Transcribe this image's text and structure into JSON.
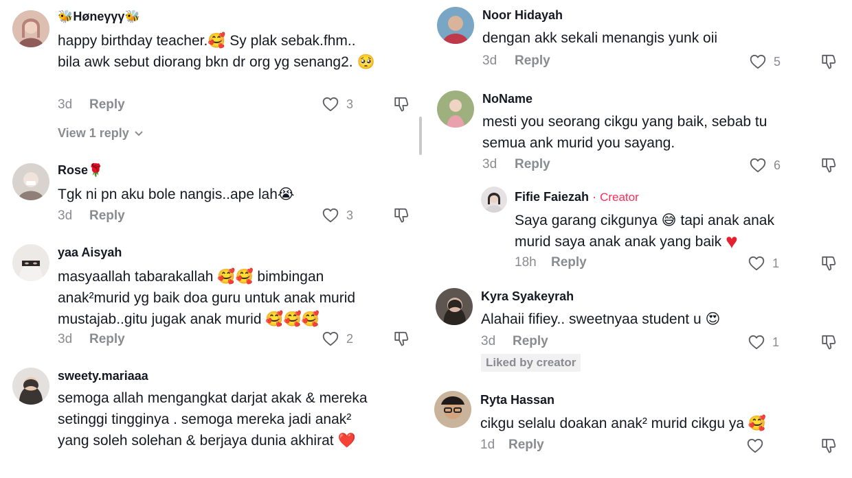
{
  "colors": {
    "text": "#161823",
    "muted": "#8a8b91",
    "creator": "#fe2c55",
    "heart": "#e5202f",
    "badge_bg": "#f1f1f2"
  },
  "left": {
    "c1": {
      "name": "🐝Høneγγγ🐝",
      "text": "happy birthday teacher.🥰 Sy plak sebak.fhm.. bila awk sebut diorang bkn dr org yg senang2. 🥺",
      "age": "3d",
      "reply": "Reply",
      "likes": "3",
      "view_replies": "View 1 reply"
    },
    "c2": {
      "name": "Rose🌹",
      "text": "Tgk ni pn aku bole nangis..ape lah😭",
      "age": "3d",
      "reply": "Reply",
      "likes": "3"
    },
    "c3": {
      "name": "yaa Aisyah",
      "text": "masyaallah tabarakallah 🥰🥰 bimbingan anak²murid yg baik doa guru untuk anak murid mustajab..gitu jugak anak murid 🥰🥰🥰",
      "age": "3d",
      "reply": "Reply",
      "likes": "2"
    },
    "c4": {
      "name": "sweety.mariaaa",
      "text": "semoga allah mengangkat darjat akak & mereka setinggi tingginya . semoga mereka jadi anak² yang soleh solehan & berjaya dunia akhirat ❤️"
    }
  },
  "right": {
    "c1": {
      "name": "Noor Hidayah",
      "text": "dengan akk sekali menangis yunk oii",
      "age": "3d",
      "reply": "Reply",
      "likes": "5"
    },
    "c2": {
      "name": "NoName",
      "text": "mesti you seorang cikgu yang baik, sebab tu semua ank murid you sayang.",
      "age": "3d",
      "reply": "Reply",
      "likes": "6"
    },
    "c3": {
      "name": "Fifie Faiezah",
      "dot": "·",
      "creator": "Creator",
      "text_a": "Saya garang cikgunya 😅 tapi anak anak murid saya anak anak yang baik ",
      "heart": "♥",
      "age": "18h",
      "reply": "Reply",
      "likes": "1"
    },
    "c4": {
      "name": "Kyra Syakeyrah",
      "text": "Alahaii fifiey.. sweetnyaa student u 😍",
      "age": "3d",
      "reply": "Reply",
      "likes": "1",
      "liked_by": "Liked by creator"
    },
    "c5": {
      "name": "Ryta Hassan",
      "text": "cikgu selalu doakan anak² murid cikgu ya 🥰",
      "age": "1d",
      "reply": "Reply"
    }
  }
}
